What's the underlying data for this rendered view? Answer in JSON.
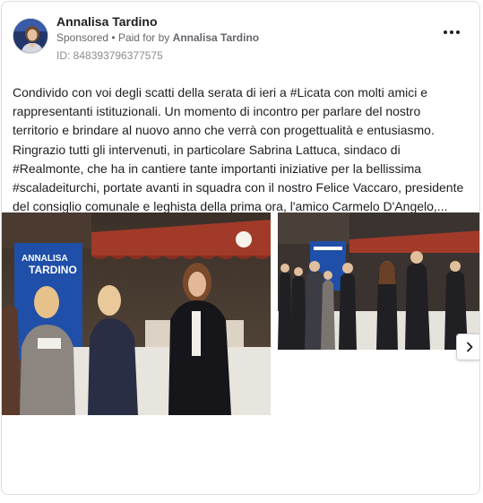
{
  "post": {
    "author": "Annalisa Tardino",
    "sponsored": "Sponsored",
    "separator": "•",
    "paid_for_prefix": "Paid for by",
    "paid_for_by": "Annalisa Tardino",
    "ad_id": "ID: 848393796377575",
    "text": "Condivido con voi degli scatti della serata di ieri a #Licata con molti amici e rappresentanti istituzionali. Un momento di incontro per parlare del nostro territorio e brindare al nuovo anno che verrà con progettualità e entusiasmo. Ringrazio tutti gli intervenuti, in particolare Sabrina Lattuca, sindaco di #Realmonte, che ha in cantiere tante importanti iniziative per la bellissima #scaladeiturchi, portate avanti in squadra con il nostro Felice Vaccaro, presidente del consiglio comunale e leghista della prima ora, l'amico Carmelo D'Angelo,..."
  },
  "banner": {
    "line1": "ANNALISA",
    "line2": "TARDINO"
  },
  "icons": {
    "more": "more-options-icon",
    "next": "chevron-right-icon"
  },
  "colors": {
    "name": "#1c1e21",
    "meta": "#65676b",
    "banner_blue": "#1f4fa8"
  }
}
